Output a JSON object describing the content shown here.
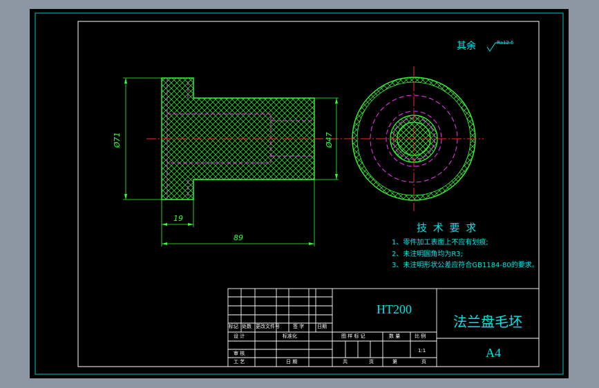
{
  "surface_finish": {
    "label": "其余",
    "symbol_value": "Ra12.5"
  },
  "dimensions": {
    "outer_diameter": "Ø71",
    "inner_diameter": "Ø47",
    "flange_thickness": "19",
    "total_length": "89"
  },
  "tech_requirements": {
    "title": "技 术 要 求",
    "items": [
      "1、零件加工表面上不应有划痕;",
      "2、未注明圆角均为R3;",
      "3、未注明形状公差应符合GB1184-80的要求。"
    ]
  },
  "title_block": {
    "material": "HT200",
    "part_name": "法兰盘毛坯",
    "sheet_size": "A4",
    "revision_headers": [
      "标记",
      "处数",
      "更改文件号",
      "签 字",
      "日期"
    ],
    "design": "设 计",
    "standardization": "标准化",
    "review": "审 核",
    "process": "工 艺",
    "date": "日 期",
    "stage_mark": "图 样 标 记",
    "weight": "数 量",
    "scale": "比 例",
    "scale_value": "1:1",
    "total_sheets": "共",
    "sheets_unit": "页",
    "sheet_no": "第",
    "sheet_unit2": "页"
  },
  "colors": {
    "frame": "#ffffff",
    "outline": "#33ff33",
    "centerline": "#ff2a2a",
    "hidden": "#ff33ff",
    "hatch": "#33ff33",
    "text": "#00e5e5"
  }
}
